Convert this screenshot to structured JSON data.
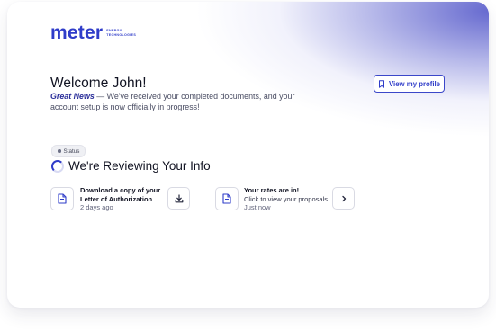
{
  "brand": {
    "name": "meter",
    "tagline_line1": "ENERGY",
    "tagline_line2": "TECHNOLOGIES",
    "accent": "#2f3cc9",
    "gradient_color": "#5c60cc"
  },
  "header": {
    "welcome": "Welcome John!",
    "great_news": "Great News",
    "message": " — We've received your completed documents, and your account setup is now officially in progress!",
    "profile_button": "View my profile"
  },
  "status": {
    "badge": "Status",
    "title": "We're Reviewing Your Info"
  },
  "items": [
    {
      "title_line1": "Download a copy of your",
      "title_line2": "Letter of Authorization",
      "time": "2 days ago",
      "doc_icon": "document-icon",
      "action_icon": "download-icon"
    },
    {
      "title": "Your rates are in!",
      "subtitle": "Click to view your proposals",
      "time": "Just now",
      "doc_icon": "document-icon",
      "action_icon": "chevron-right-icon"
    }
  ]
}
